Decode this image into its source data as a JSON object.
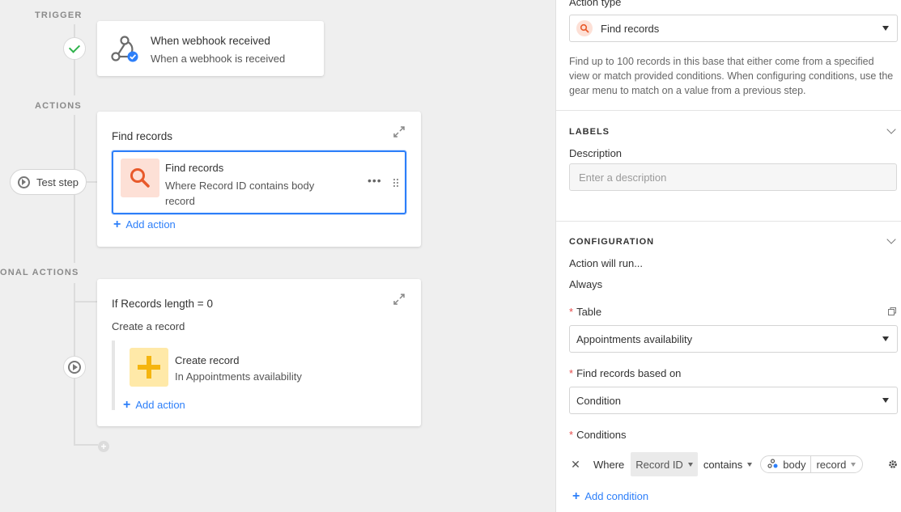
{
  "canvas": {
    "sections": {
      "trigger": "TRIGGER",
      "actions": "ACTIONS",
      "conditional": "ONAL ACTIONS"
    },
    "trigger_card": {
      "title": "When webhook received",
      "subtitle": "When a webhook is received"
    },
    "action_card": {
      "title": "Find records",
      "step_title": "Find records",
      "step_subtitle": "Where Record ID contains body record",
      "add_action": "Add action"
    },
    "test_step": "Test step",
    "conditional_card": {
      "condition": "If Records length = 0",
      "group_label": "Create a record",
      "step_title": "Create record",
      "step_subtitle": "In Appointments availability",
      "add_action": "Add action"
    }
  },
  "panel": {
    "action_type_label": "Action type",
    "action_type_value": "Find records",
    "description": "Find up to 100 records in this base that either come from a specified view or match provided conditions. When configuring conditions, use the gear menu to match on a value from a previous step.",
    "labels_section": "LABELS",
    "description_label": "Description",
    "description_placeholder": "Enter a description",
    "configuration_section": "CONFIGURATION",
    "action_will_run": "Action will run...",
    "run_value": "Always",
    "table_label": "Table",
    "table_value": "Appointments availability",
    "find_based_label": "Find records based on",
    "find_based_value": "Condition",
    "conditions_label": "Conditions",
    "condition": {
      "where": "Where",
      "field": "Record ID",
      "operator": "contains",
      "token_source": "body",
      "token_field": "record"
    },
    "add_condition": "Add condition"
  },
  "colors": {
    "accent": "#2d7ff9",
    "required": "#e54b4b",
    "success": "#2eb24b",
    "search_tile": "#fde0d6",
    "create_tile": "#ffe9a8"
  }
}
